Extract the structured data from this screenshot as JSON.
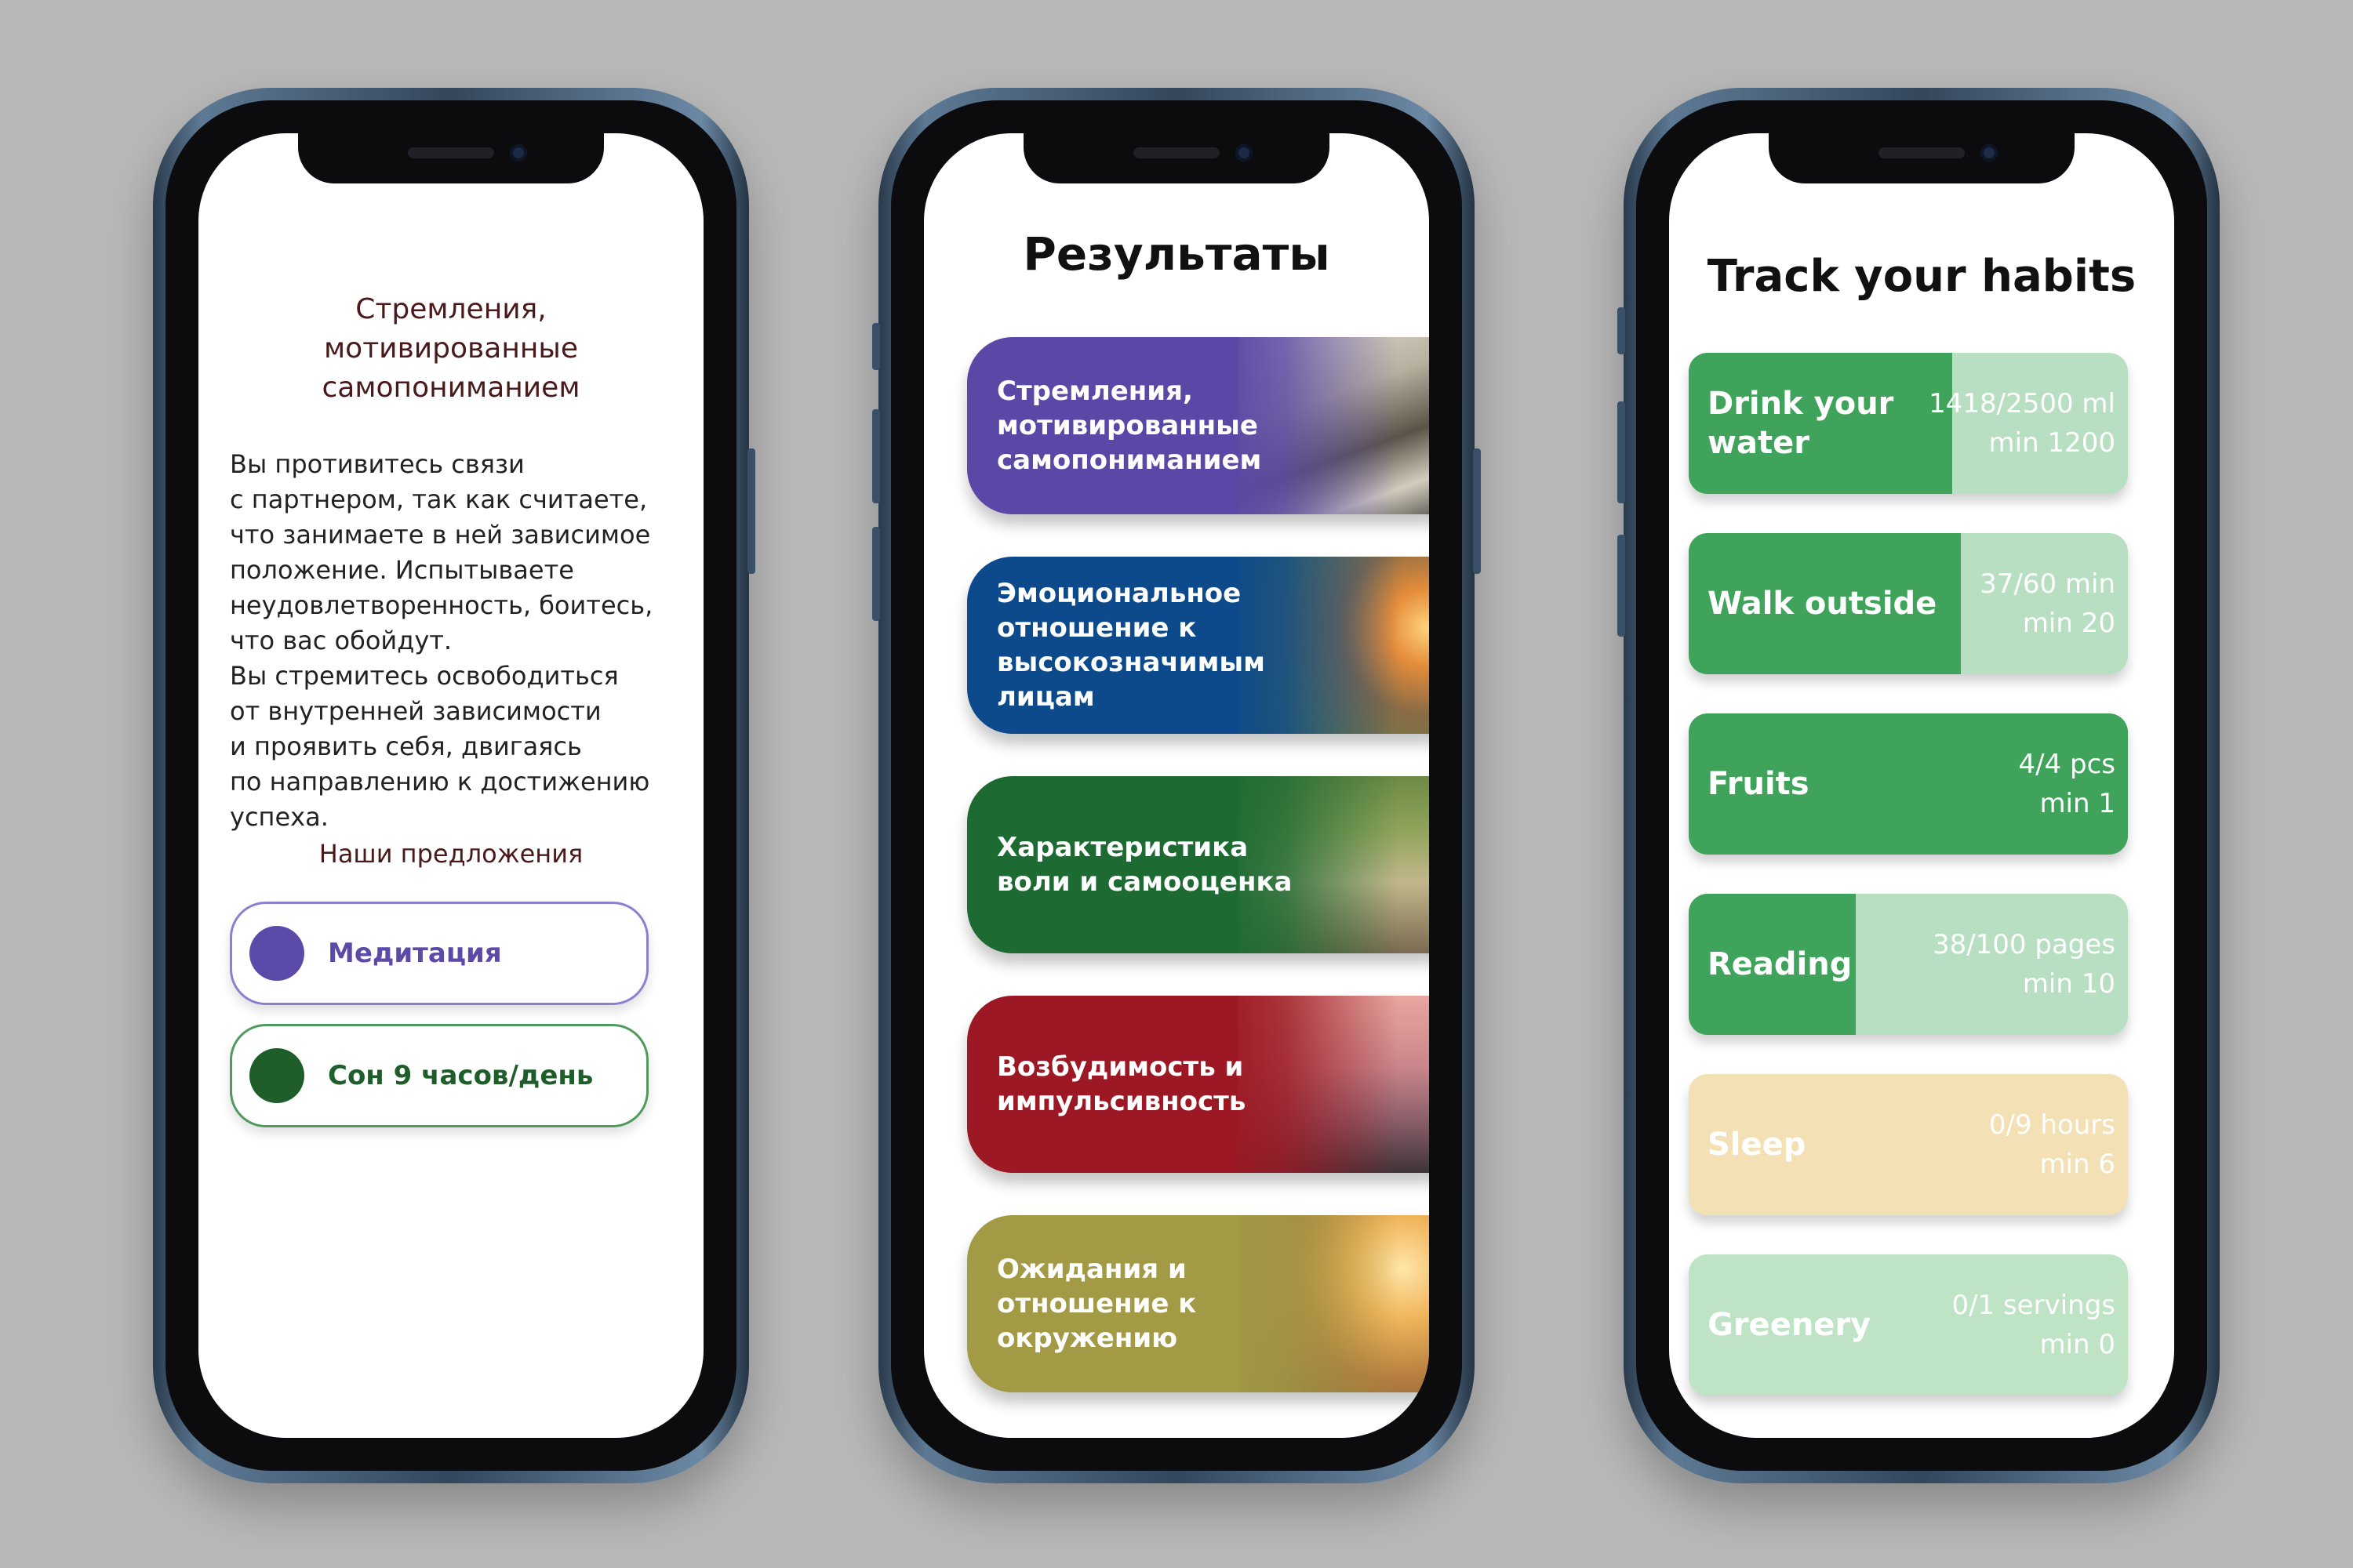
{
  "colors": {
    "background": "#b8b8b8",
    "meditation": "#5b4aa8",
    "sleep": "#1f5e2a",
    "habit_green": "#3fa35b",
    "habit_light_green": "#b9dfc2",
    "habit_yellow": "#f3e0b4",
    "habit_greenery": "#bfe3c5"
  },
  "phone1": {
    "title": "Стремления,\nмотивированные\nсамопониманием",
    "body": "Вы противитесь связи\nс партнером, так как считаете,\nчто занимаете в ней зависимое\nположение. Испытываете\nнеудовлетворенность, боитесь,\nчто вас обойдут.\nВы стремитесь освободиться\nот внутренней зависимости\nи проявить себя, двигаясь\nпо направлению к достижению\nуспеха.",
    "offers_title": "Наши предложения",
    "offers": [
      {
        "label": "Медитация",
        "color": "#5b4aa8"
      },
      {
        "label": "Сон 9 часов/день",
        "color": "#1f5e2a"
      }
    ]
  },
  "phone2": {
    "title": "Результаты",
    "cards": [
      {
        "label": "Стремления, мотивированные самопониманием",
        "color": "#5b48a6",
        "photo": "papers"
      },
      {
        "label": "Эмоциональное отношение к высокозначимым лицам",
        "color": "#0d4a8c",
        "photo": "family"
      },
      {
        "label": "Характеристика воли и самооценка",
        "color": "#1d6a33",
        "photo": "runner"
      },
      {
        "label": "Возбудимость и импульсивность",
        "color": "#9c1824",
        "photo": "mountain"
      },
      {
        "label": "Ожидания и отношение к окружению",
        "color": "#a39a45",
        "photo": "friends"
      }
    ]
  },
  "phone3": {
    "title": "Track your habits",
    "habits": [
      {
        "name": "Drink your water",
        "progress": "1418/2500 ml",
        "min": "min 1200",
        "fraction": 0.6
      },
      {
        "name": "Walk outside",
        "progress": "37/60 min",
        "min": "min 20",
        "fraction": 0.65
      },
      {
        "name": "Fruits",
        "progress": "4/4 pcs",
        "min": "min 1",
        "fraction": 1.0
      },
      {
        "name": "Reading",
        "progress": "38/100 pages",
        "min": "min 10",
        "fraction": 0.38
      },
      {
        "name": "Sleep",
        "progress": "0/9 hours",
        "min": "min 6",
        "fraction": 0.0
      },
      {
        "name": "Greenery",
        "progress": "0/1 servings",
        "min": "min 0",
        "fraction": 0.0
      }
    ]
  }
}
